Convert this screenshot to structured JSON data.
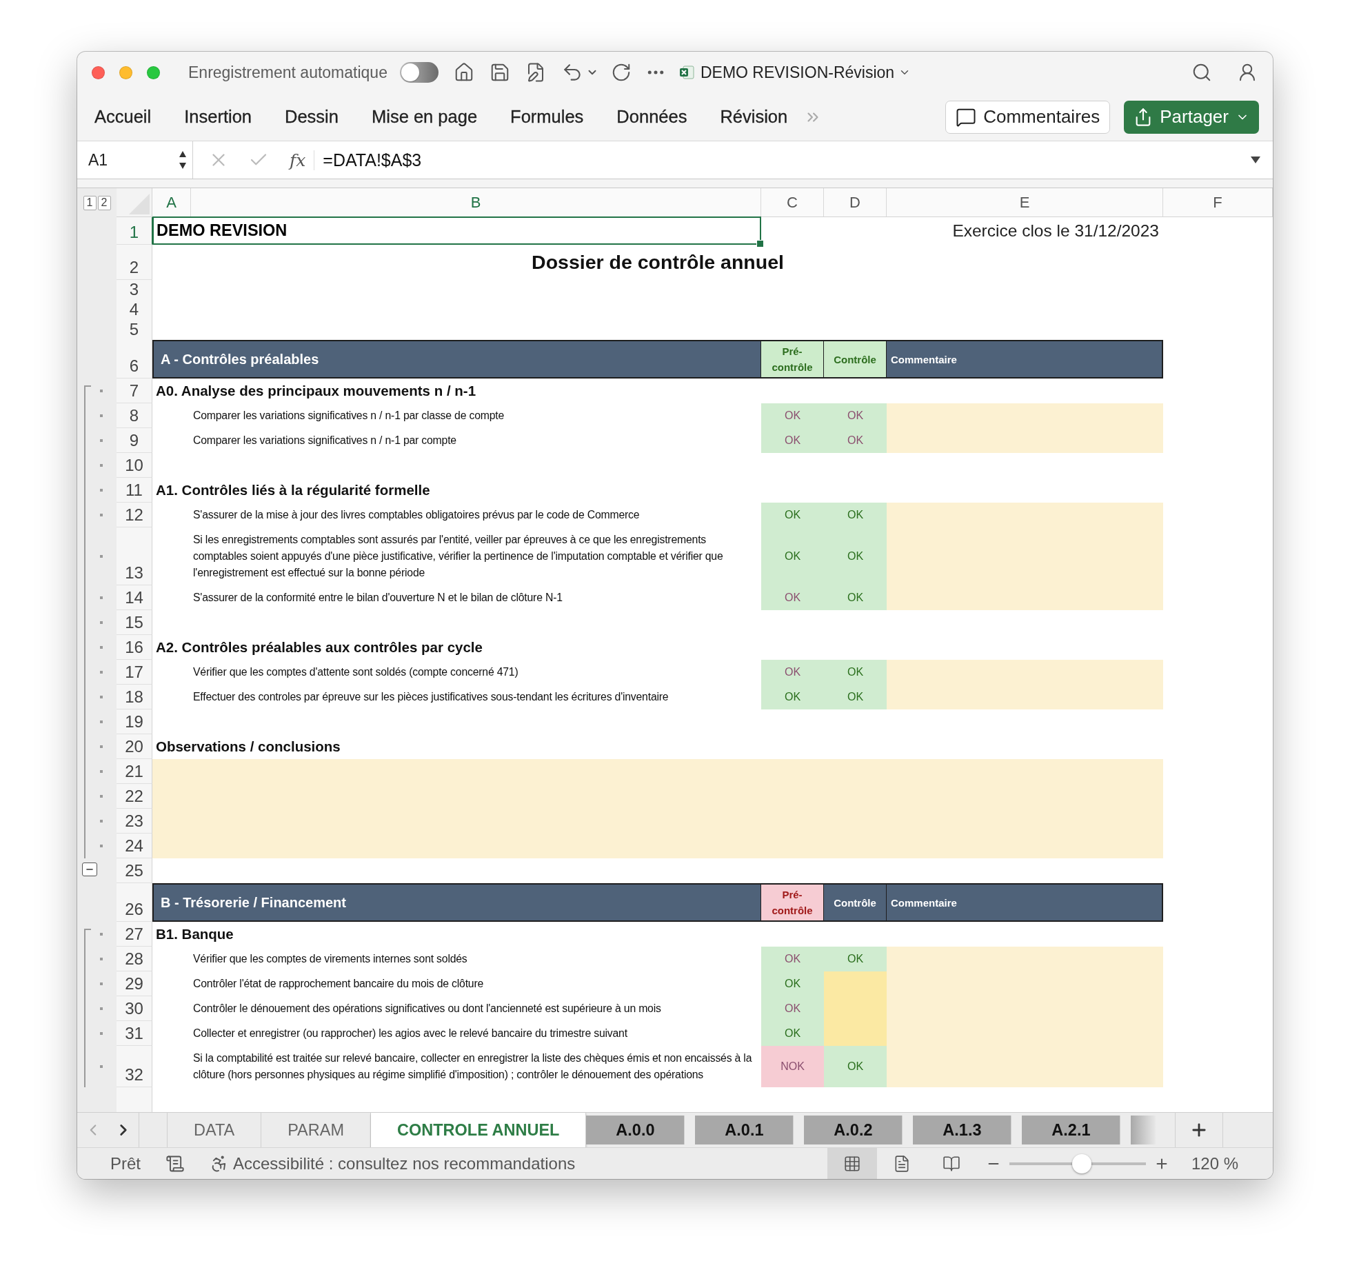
{
  "titlebar": {
    "autosave_label": "Enregistrement automatique",
    "autosave": {
      "on": false
    },
    "title": "DEMO REVISION-Révision"
  },
  "ribbon": {
    "tabs": [
      {
        "label": "Accueil"
      },
      {
        "label": "Insertion"
      },
      {
        "label": "Dessin"
      },
      {
        "label": "Mise en page"
      },
      {
        "label": "Formules"
      },
      {
        "label": "Données"
      },
      {
        "label": "Révision"
      }
    ],
    "comments_button": "Commentaires",
    "share_button": "Partager"
  },
  "formula_bar": {
    "name_box": "A1",
    "function_button": "fx",
    "formula": "=DATA!$A$3"
  },
  "outline_levels": [
    "1",
    "2"
  ],
  "columns": [
    {
      "label": "A",
      "selected": true
    },
    {
      "label": "B",
      "selected": true
    },
    {
      "label": "C",
      "selected": false
    },
    {
      "label": "D",
      "selected": false
    },
    {
      "label": "E",
      "selected": false
    },
    {
      "label": "F",
      "selected": false
    }
  ],
  "rows": [
    {
      "number": "1",
      "selected": true,
      "kind": "title",
      "text": "DEMO REVISION",
      "date": "Exercice clos le 31/12/2023"
    },
    {
      "number": "2",
      "selected": false,
      "kind": "heading",
      "text": "Dossier de contrôle annuel"
    },
    {
      "number": "3",
      "selected": false,
      "kind": "spacer"
    },
    {
      "number": "4",
      "selected": false,
      "kind": "spacer"
    },
    {
      "number": "5",
      "selected": false,
      "kind": "spacer"
    },
    {
      "number": "6",
      "selected": false,
      "kind": "section",
      "text": "A - Contrôles préalables",
      "pre": {
        "text": "Pré-contrôle",
        "kind": "ok"
      },
      "control": {
        "text": "Contrôle",
        "kind": "ok"
      },
      "comment": "Commentaire"
    },
    {
      "number": "7",
      "selected": false,
      "kind": "group",
      "outlined": true,
      "outline_start": true,
      "text": "A0. Analyse des principaux mouvements n / n-1"
    },
    {
      "number": "8",
      "selected": false,
      "kind": "item",
      "outlined": true,
      "text": "Comparer les variations significatives n / n-1 par classe de compte",
      "pre": {
        "text": "OK",
        "kind": "ok",
        "color": "#8b4f6f"
      },
      "control": {
        "text": "OK",
        "kind": "ok",
        "color": "#8b4f6f"
      }
    },
    {
      "number": "9",
      "selected": false,
      "kind": "item",
      "outlined": true,
      "text": "Comparer les variations significatives n / n-1 par compte",
      "pre": {
        "text": "OK",
        "kind": "ok",
        "color": "#8b4f6f"
      },
      "control": {
        "text": "OK",
        "kind": "ok",
        "color": "#8b4f6f"
      }
    },
    {
      "number": "10",
      "selected": false,
      "kind": "blank",
      "outlined": true
    },
    {
      "number": "11",
      "selected": false,
      "kind": "group",
      "outlined": true,
      "text": "A1. Contrôles liés à la régularité formelle"
    },
    {
      "number": "12",
      "selected": false,
      "kind": "item",
      "outlined": true,
      "text": "S'assurer de la mise à jour des livres comptables obligatoires prévus par le code de Commerce",
      "pre": {
        "text": "OK",
        "kind": "ok",
        "color": "#2a6e1c"
      },
      "control": {
        "text": "OK",
        "kind": "ok",
        "color": "#2a6e1c"
      }
    },
    {
      "number": "13",
      "selected": false,
      "kind": "item",
      "outlined": true,
      "text": "Si les enregistrements comptables sont assurés par l'entité, veiller par épreuves à ce que les enregistrements\ncomptables soient appuyés d'une pièce justificative, vérifier la pertinence de l'imputation comptable et vérifier que\nl'enregistrement est effectué sur la bonne période",
      "pre": {
        "text": "OK",
        "kind": "ok",
        "color": "#2a6e1c"
      },
      "control": {
        "text": "OK",
        "kind": "ok",
        "color": "#2a6e1c"
      }
    },
    {
      "number": "14",
      "selected": false,
      "kind": "item",
      "outlined": true,
      "text": "S'assurer de la conformité entre le bilan d'ouverture N et le bilan de clôture N-1",
      "pre": {
        "text": "OK",
        "kind": "ok",
        "color": "#8b4f6f"
      },
      "control": {
        "text": "OK",
        "kind": "ok",
        "color": "#2a6e1c"
      }
    },
    {
      "number": "15",
      "selected": false,
      "kind": "blank",
      "outlined": true
    },
    {
      "number": "16",
      "selected": false,
      "kind": "group",
      "outlined": true,
      "text": "A2. Contrôles préalables aux contrôles par cycle"
    },
    {
      "number": "17",
      "selected": false,
      "kind": "item",
      "outlined": true,
      "text": "Vérifier que les comptes d'attente sont soldés (compte concerné 471)",
      "pre": {
        "text": "OK",
        "kind": "ok",
        "color": "#8b4f6f"
      },
      "control": {
        "text": "OK",
        "kind": "ok",
        "color": "#2a6e1c"
      }
    },
    {
      "number": "18",
      "selected": false,
      "kind": "item",
      "outlined": true,
      "text": "Effectuer des controles par épreuve sur les pièces justificatives sous-tendant les écritures d'inventaire",
      "pre": {
        "text": "OK",
        "kind": "ok",
        "color": "#2a6e1c"
      },
      "control": {
        "text": "OK",
        "kind": "ok",
        "color": "#2a6e1c"
      }
    },
    {
      "number": "19",
      "selected": false,
      "kind": "blank",
      "outlined": true
    },
    {
      "number": "20",
      "selected": false,
      "kind": "group",
      "outlined": true,
      "text": "Observations / conclusions"
    },
    {
      "number": "21",
      "selected": false,
      "kind": "note",
      "outlined": true
    },
    {
      "number": "22",
      "selected": false,
      "kind": "note",
      "outlined": true
    },
    {
      "number": "23",
      "selected": false,
      "kind": "note",
      "outlined": true
    },
    {
      "number": "24",
      "selected": false,
      "kind": "note",
      "outlined": true
    },
    {
      "number": "25",
      "selected": false,
      "kind": "blank",
      "collapse_button": true
    },
    {
      "number": "26",
      "selected": false,
      "kind": "section",
      "text": "B - Trésorerie / Financement",
      "pre": {
        "text": "Pré-contrôle",
        "kind": "nok"
      },
      "control": {
        "text": "Contrôle",
        "kind": "plain"
      },
      "comment": "Commentaire"
    },
    {
      "number": "27",
      "selected": false,
      "kind": "group",
      "outlined": true,
      "outline_start": true,
      "text": "B1. Banque"
    },
    {
      "number": "28",
      "selected": false,
      "kind": "item",
      "outlined": true,
      "text": "Vérifier que les comptes de virements internes sont soldés",
      "pre": {
        "text": "OK",
        "kind": "ok",
        "color": "#8b4f6f"
      },
      "control": {
        "text": "OK",
        "kind": "ok",
        "color": "#2a6e1c"
      }
    },
    {
      "number": "29",
      "selected": false,
      "kind": "item",
      "outlined": true,
      "text": "Contrôler l'état de rapprochement bancaire du mois de clôture",
      "pre": {
        "text": "OK",
        "kind": "ok",
        "color": "#2a6e1c"
      },
      "control": {
        "kind": "empty"
      }
    },
    {
      "number": "30",
      "selected": false,
      "kind": "item",
      "outlined": true,
      "text": "Contrôler le dénouement des opérations significatives ou dont l'ancienneté est supérieure à un mois",
      "pre": {
        "text": "OK",
        "kind": "ok",
        "color": "#8b4f6f"
      },
      "control": {
        "kind": "empty"
      }
    },
    {
      "number": "31",
      "selected": false,
      "kind": "item",
      "outlined": true,
      "text": "Collecter et enregistrer (ou rapprocher) les agios avec le relevé bancaire du trimestre suivant",
      "pre": {
        "text": "OK",
        "kind": "ok",
        "color": "#2a6e1c"
      },
      "control": {
        "kind": "empty"
      }
    },
    {
      "number": "32",
      "selected": false,
      "kind": "item",
      "outlined": true,
      "text": "Si la comptabilité est traitée sur relevé bancaire, collecter en enregistrer la liste des chèques émis et non encaissés à la\nclôture (hors personnes physiques au régime simplifié d'imposition) ; contrôler le dénouement des opérations",
      "pre": {
        "text": "NOK",
        "kind": "nok",
        "color": "#8b4f6f"
      },
      "control": {
        "text": "OK",
        "kind": "ok",
        "color": "#2a6e1c"
      }
    }
  ],
  "sheet_tabs": [
    {
      "label": "DATA",
      "kind": "plain",
      "selected": false
    },
    {
      "label": "PARAM",
      "kind": "plain",
      "selected": false
    },
    {
      "label": "CONTROLE ANNUEL",
      "kind": "plain",
      "selected": true
    },
    {
      "label": "A.0.0",
      "kind": "colored",
      "selected": false
    },
    {
      "label": "A.0.1",
      "kind": "colored",
      "selected": false
    },
    {
      "label": "A.0.2",
      "kind": "colored",
      "selected": false
    },
    {
      "label": "A.1.3",
      "kind": "colored",
      "selected": false
    },
    {
      "label": "A.2.1",
      "kind": "colored",
      "selected": false
    },
    {
      "kind": "partial",
      "selected": false
    }
  ],
  "status_bar": {
    "status": "Prêt",
    "accessibility": "Accessibilité : consultez nos recommandations",
    "views": [
      {
        "kind": "normal",
        "selected": true
      },
      {
        "kind": "page-layout",
        "selected": false
      },
      {
        "kind": "page-break",
        "selected": false
      }
    ],
    "zoom": {
      "level": 0.53,
      "reading": "120 %"
    }
  }
}
